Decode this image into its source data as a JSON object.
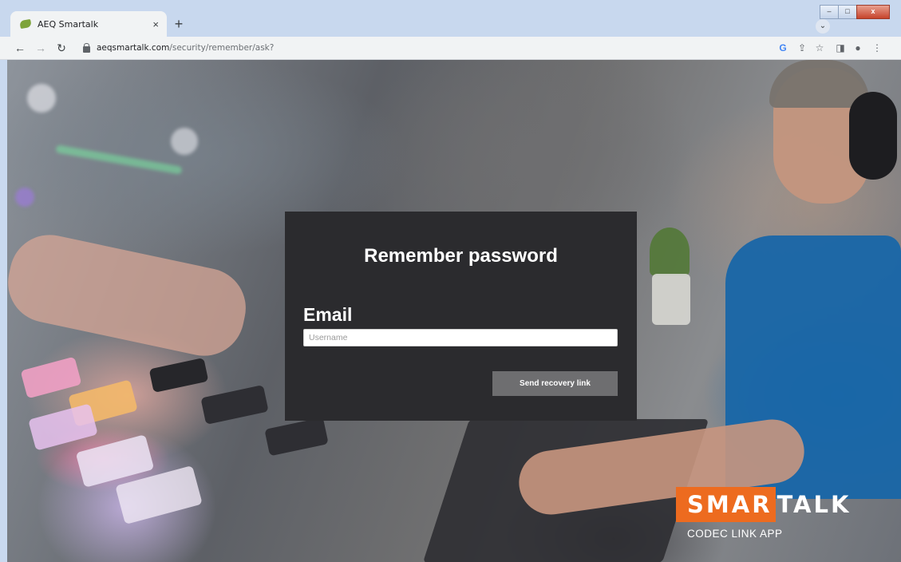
{
  "browser": {
    "tab_title": "AEQ Smartalk",
    "tab_close": "×",
    "new_tab": "+",
    "url_host": "aeqsmartalk.com",
    "url_path": "/security/remember/ask?",
    "window_buttons": [
      "–",
      "□",
      "x"
    ]
  },
  "dialog": {
    "title": "Remember password",
    "email_label": "Email",
    "email_placeholder": "Username",
    "email_value": "",
    "send_button": "Send recovery link"
  },
  "logo": {
    "word_highlight": "SMAR",
    "word_rest": "TALK",
    "subtitle": "CODEC LINK APP",
    "colors": {
      "orange": "#ed6b1f"
    }
  }
}
